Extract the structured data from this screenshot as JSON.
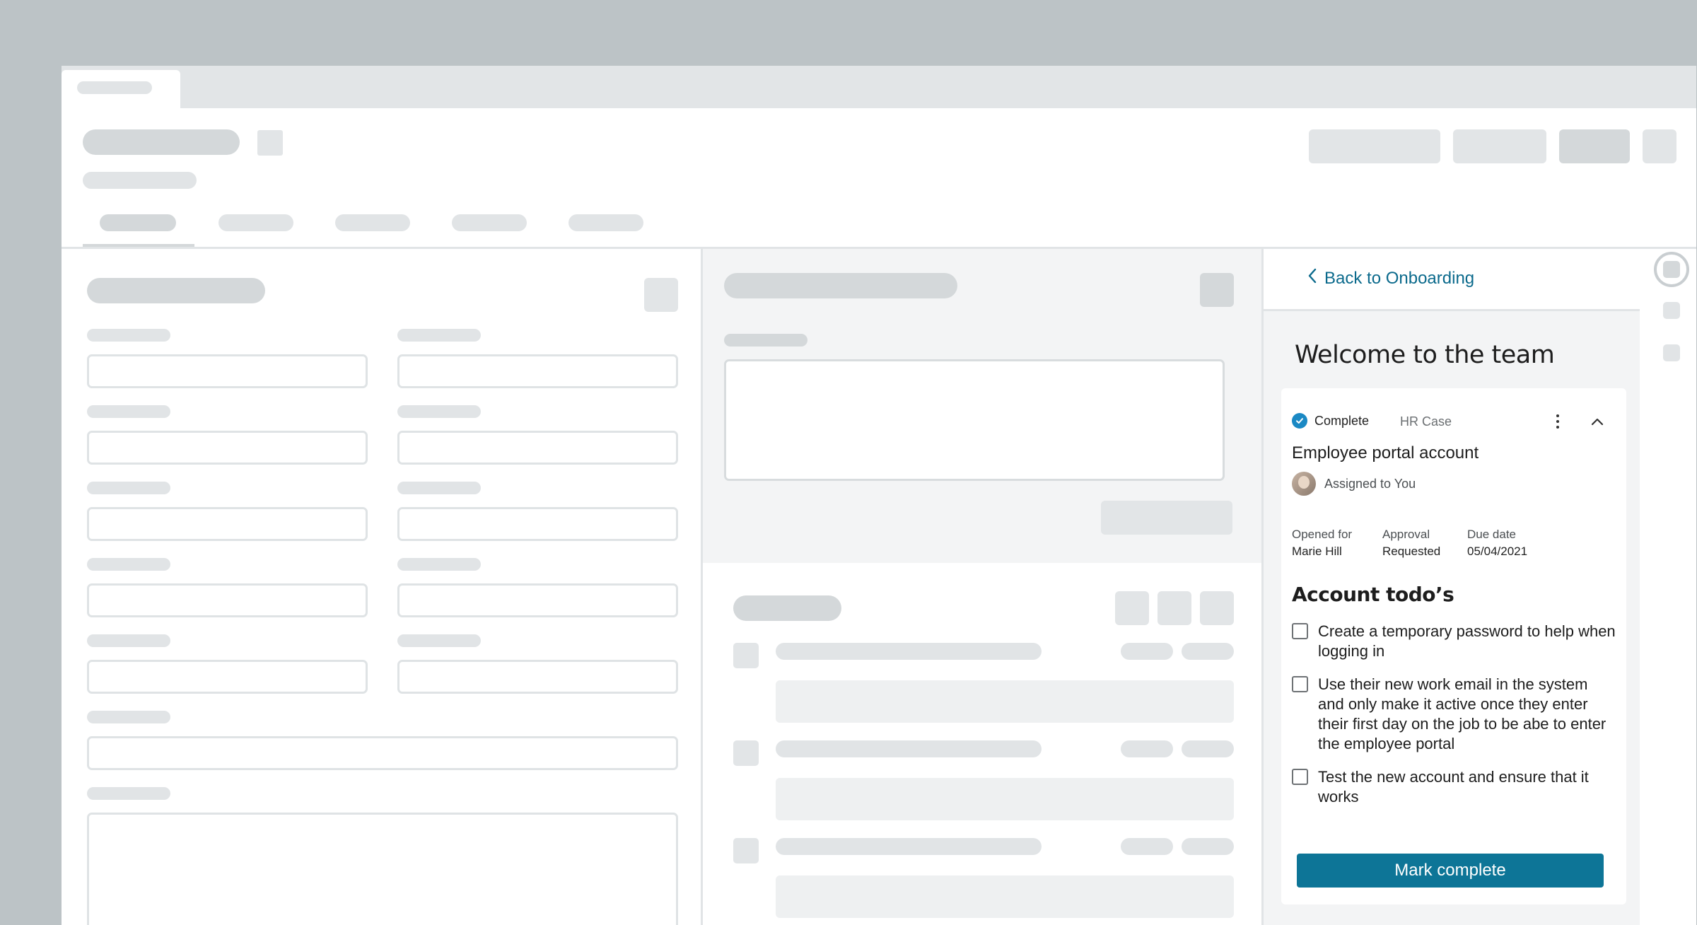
{
  "panel": {
    "back_label": "Back to Onboarding",
    "title": "Welcome to the team",
    "card": {
      "status": "Complete",
      "case_type": "HR Case",
      "item_title": "Employee portal account",
      "assigned": "Assigned to You",
      "meta": [
        {
          "label": "Opened for",
          "value": "Marie Hill"
        },
        {
          "label": "Approval",
          "value": "Requested"
        },
        {
          "label": "Due date",
          "value": "05/04/2021"
        }
      ],
      "section_title": "Account todo’s",
      "todos": [
        {
          "text": "Create a temporary password to help when logging in",
          "checked": false
        },
        {
          "text": "Use their new work email in the system and only make it active once they enter their first day on the job to be abe to enter the employee portal",
          "checked": false
        },
        {
          "text": "Test the new account and ensure that it works",
          "checked": false
        }
      ],
      "button_label": "Mark complete"
    }
  },
  "icons": {
    "back": "chevron-left-icon",
    "status": "check-circle-icon",
    "more": "more-vertical-icon",
    "collapse": "chevron-up-icon"
  },
  "colors": {
    "accent": "#0d7597",
    "link": "#0b6a8c",
    "status": "#1b89c4",
    "frame": "#bcc3c6"
  }
}
